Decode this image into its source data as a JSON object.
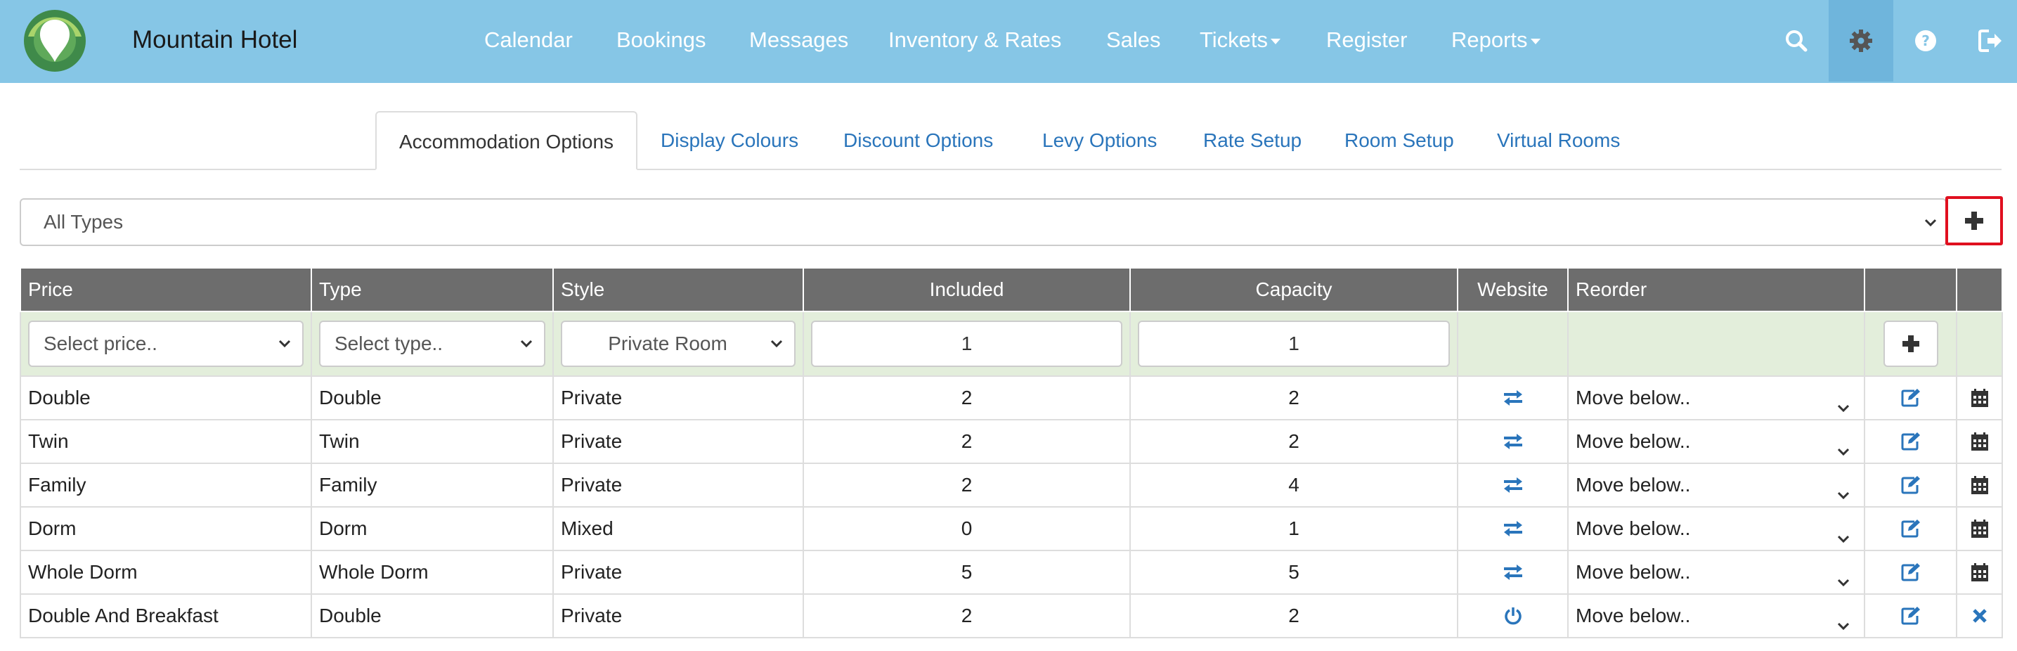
{
  "brand": {
    "name": "Mountain Hotel"
  },
  "nav": {
    "calendar": "Calendar",
    "bookings": "Bookings",
    "messages": "Messages",
    "inventory": "Inventory & Rates",
    "sales": "Sales",
    "tickets": "Tickets",
    "register": "Register",
    "reports": "Reports"
  },
  "tabs": [
    "Accommodation Options",
    "Display Colours",
    "Discount Options",
    "Levy Options",
    "Rate Setup",
    "Room Setup",
    "Virtual Rooms"
  ],
  "type_filter": {
    "value": "All Types"
  },
  "table": {
    "headers": {
      "price": "Price",
      "type": "Type",
      "style": "Style",
      "included": "Included",
      "capacity": "Capacity",
      "website": "Website",
      "reorder": "Reorder"
    },
    "new_row": {
      "price_placeholder": "Select price..",
      "type_placeholder": "Select type..",
      "style": "Private Room",
      "included": "1",
      "capacity": "1"
    },
    "rows": [
      {
        "price": "Double",
        "type": "Double",
        "style": "Private",
        "included": "2",
        "capacity": "2",
        "website": "exchange-icon",
        "reorder": "Move below..",
        "last": "calendar-icon"
      },
      {
        "price": "Twin",
        "type": "Twin",
        "style": "Private",
        "included": "2",
        "capacity": "2",
        "website": "exchange-icon",
        "reorder": "Move below..",
        "last": "calendar-icon"
      },
      {
        "price": "Family",
        "type": "Family",
        "style": "Private",
        "included": "2",
        "capacity": "4",
        "website": "exchange-icon",
        "reorder": "Move below..",
        "last": "calendar-icon"
      },
      {
        "price": "Dorm",
        "type": "Dorm",
        "style": "Mixed",
        "included": "0",
        "capacity": "1",
        "website": "exchange-icon",
        "reorder": "Move below..",
        "last": "calendar-icon"
      },
      {
        "price": "Whole Dorm",
        "type": "Whole Dorm",
        "style": "Private",
        "included": "5",
        "capacity": "5",
        "website": "exchange-icon",
        "reorder": "Move below..",
        "last": "calendar-icon"
      },
      {
        "price": "Double And Breakfast",
        "type": "Double",
        "style": "Private",
        "included": "2",
        "capacity": "2",
        "website": "power-icon",
        "reorder": "Move below..",
        "last": "close-icon"
      }
    ]
  },
  "colors": {
    "navbar": "#86c6e6",
    "link": "#2a75bb",
    "header": "#6d6d6d",
    "filter_row": "#e3eedb",
    "highlight": "#e0101f"
  }
}
